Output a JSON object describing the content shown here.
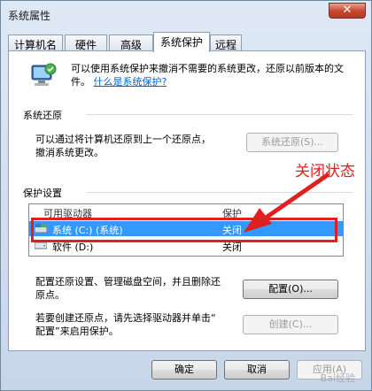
{
  "window": {
    "title": "系统属性",
    "close_glyph": "✕"
  },
  "tabs": [
    {
      "label": "计算机名",
      "active": false
    },
    {
      "label": "硬件",
      "active": false
    },
    {
      "label": "高级",
      "active": false
    },
    {
      "label": "系统保护",
      "active": true
    },
    {
      "label": "远程",
      "active": false
    }
  ],
  "intro": {
    "text": "可以使用系统保护来撤消不需要的系统更改，还原以前版本的文件。",
    "link": "什么是系统保护?"
  },
  "system_restore": {
    "section_label": "系统还原",
    "description_line1": "可以通过将计算机还原到上一个还原点，",
    "description_line2": "撤消系统更改。",
    "button_label": "系统还原(S)..."
  },
  "protection": {
    "section_label": "保护设置",
    "columns": [
      "可用驱动器",
      "保护"
    ],
    "drives": [
      {
        "name": "系统 (C:) (系统)",
        "status": "关闭",
        "selected": true
      },
      {
        "name": "软件 (D:)",
        "status": "关闭",
        "selected": false
      }
    ],
    "configure_text_line1": "配置还原设置、管理磁盘空间，并且删除还",
    "configure_text_line2": "原点。",
    "configure_button": "配置(O)...",
    "create_text_line1": "若要创建还原点，请先选择驱动器并单击“",
    "create_text_line2": "配置”来启用保护。",
    "create_button": "创建(C)..."
  },
  "annotation": {
    "text": "关闭状态",
    "color": "#e02020"
  },
  "footer": {
    "ok": "确定",
    "cancel": "取消",
    "apply": "应用(A)"
  },
  "watermark": "Bai经验"
}
